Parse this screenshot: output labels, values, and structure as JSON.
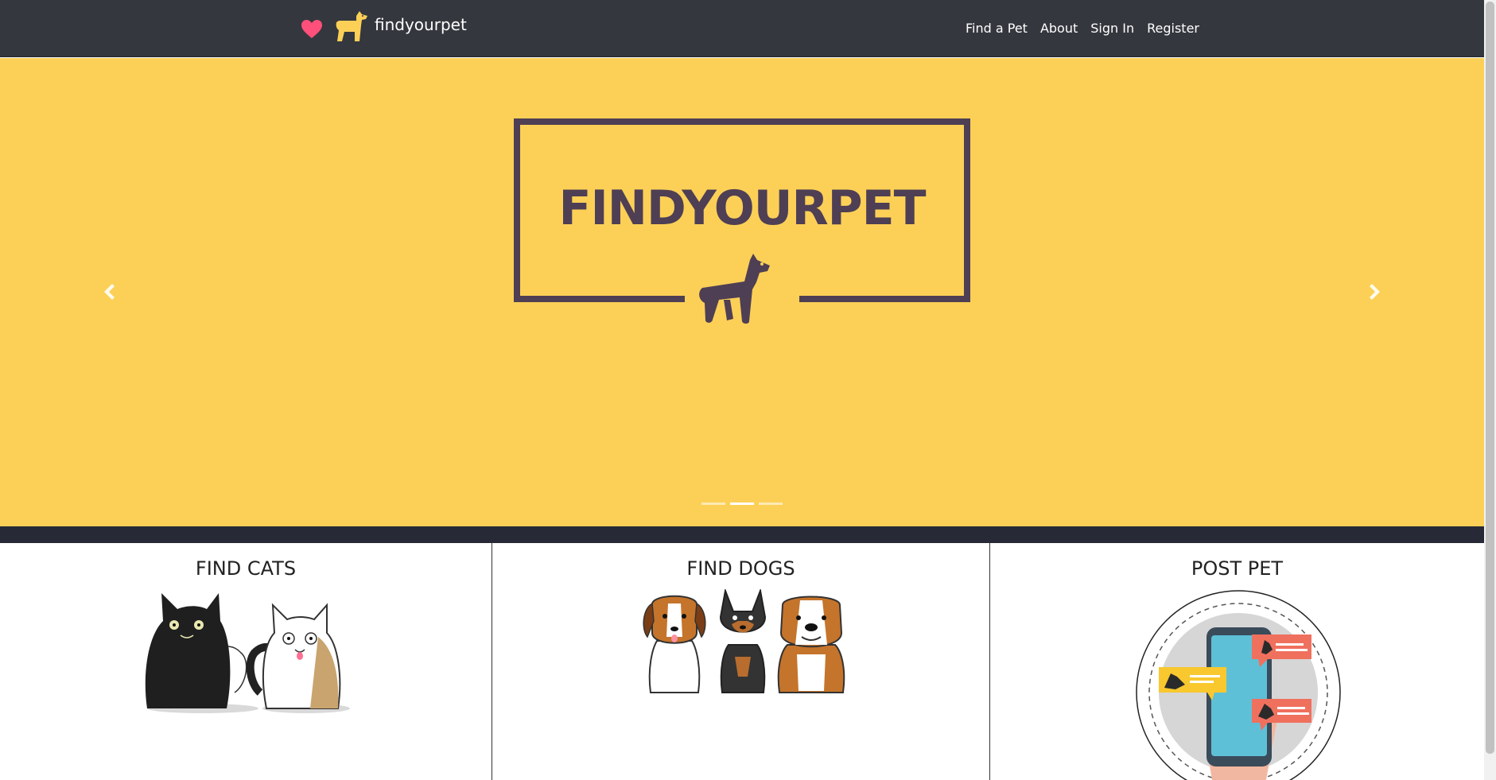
{
  "brand": {
    "name": "findyourpet"
  },
  "nav": {
    "links": [
      {
        "label": "Find a Pet"
      },
      {
        "label": "About"
      },
      {
        "label": "Sign In"
      },
      {
        "label": "Register"
      }
    ]
  },
  "carousel": {
    "slide_title": "FINDYOURPET",
    "indicator_count": 3,
    "active_indicator": 2,
    "background_color": "#fcd057",
    "accent_color": "#4e3f54"
  },
  "features": {
    "cats": {
      "title": "FIND CATS"
    },
    "dogs": {
      "title": "FIND DOGS"
    },
    "post": {
      "title": "POST PET"
    }
  },
  "colors": {
    "navbar": "#34373e",
    "heart": "#ff4f7b",
    "brand_dog": "#fcd057",
    "band": "#272936"
  }
}
